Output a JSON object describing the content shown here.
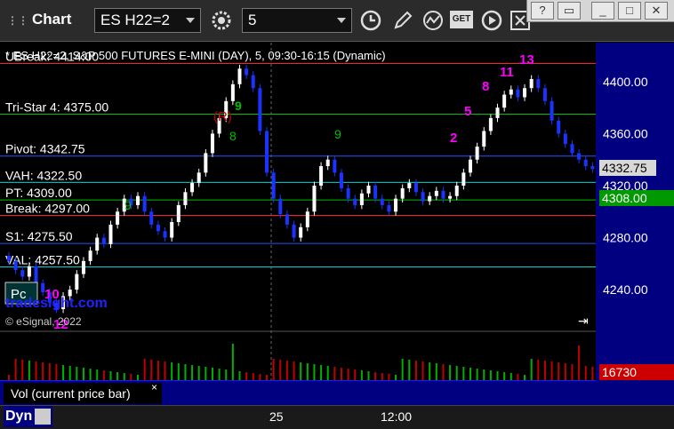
{
  "app": {
    "title": "Chart"
  },
  "toolbar": {
    "symbol": "ES H22=2",
    "interval": "5",
    "get_label": "GET"
  },
  "window_buttons": {
    "help": "?"
  },
  "chart": {
    "header": "* ES H22=2, S&P 500 FUTURES E-MINI (DAY), 5, 09:30-16:15 (Dynamic)",
    "levels": [
      {
        "label": "UBreak: 4414.00",
        "price": 4414.0,
        "color": "#ff3333"
      },
      {
        "label": "Tri-Star 4: 4375.00",
        "price": 4375.0,
        "color": "#00c000"
      },
      {
        "label": "Pivot: 4342.75",
        "price": 4342.75,
        "color": "#2255ff"
      },
      {
        "label": "VAH: 4322.50",
        "price": 4322.5,
        "color": "#00d0d0"
      },
      {
        "label": "PT: 4309.00",
        "price": 4309.0,
        "color": "#00c000"
      },
      {
        "label": "Break: 4297.00",
        "price": 4297.0,
        "color": "#ff3333"
      },
      {
        "label": "S1: 4275.50",
        "price": 4275.5,
        "color": "#2255ff"
      },
      {
        "label": "VAL: 4257.50",
        "price": 4257.5,
        "color": "#00d0d0"
      }
    ],
    "r_marker": "(R)",
    "pc_label": "Pc",
    "watermark": "tradesight.com",
    "copyright": "© eSignal, 2022",
    "seq_numbers": [
      "10",
      "12",
      "2",
      "5",
      "8",
      "11",
      "13"
    ],
    "green_counts": [
      "9",
      "8",
      "9",
      "9"
    ]
  },
  "axis": {
    "ticks": [
      "4400.00",
      "4360.00",
      "4320.00",
      "4280.00",
      "4240.00"
    ],
    "last_price": "4332.75",
    "green_price": "4308.00",
    "volume": "16730"
  },
  "indicator": {
    "label": "Vol (current price bar)",
    "close": "×"
  },
  "time_axis": {
    "labels": [
      "25",
      "12:00"
    ]
  },
  "status": {
    "mode": "Dyn"
  },
  "chart_data": {
    "type": "candlestick",
    "y_range": [
      4210,
      4430
    ],
    "y_ticks": [
      4400,
      4360,
      4320,
      4280,
      4240
    ],
    "close_series": [
      4262,
      4255,
      4250,
      4258,
      4245,
      4238,
      4230,
      4225,
      4235,
      4240,
      4252,
      4262,
      4270,
      4280,
      4275,
      4290,
      4300,
      4310,
      4305,
      4312,
      4300,
      4290,
      4285,
      4280,
      4292,
      4305,
      4315,
      4322,
      4330,
      4345,
      4360,
      4372,
      4385,
      4398,
      4410,
      4405,
      4395,
      4362,
      4330,
      4310,
      4298,
      4290,
      4280,
      4288,
      4300,
      4320,
      4335,
      4340,
      4330,
      4318,
      4310,
      4305,
      4314,
      4320,
      4310,
      4305,
      4300,
      4310,
      4318,
      4322,
      4315,
      4308,
      4312,
      4316,
      4310,
      4312,
      4320,
      4330,
      4340,
      4350,
      4362,
      4372,
      4380,
      4390,
      4394,
      4388,
      4395,
      4402,
      4395,
      4385,
      4370,
      4360,
      4352,
      4345,
      4340,
      4335,
      4332.75
    ],
    "last_price": 4332.75,
    "last_volume": 16730
  }
}
